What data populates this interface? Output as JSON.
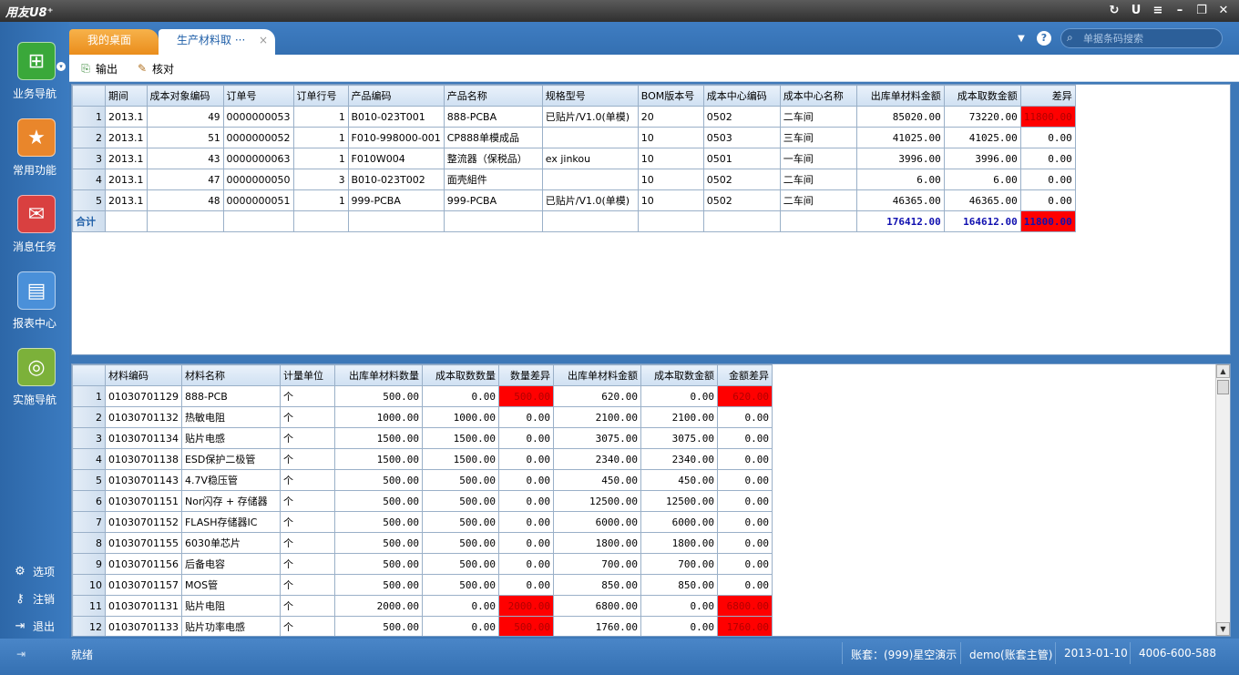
{
  "app": {
    "logo": "用友U8⁺"
  },
  "window_controls": {
    "refresh": "↻",
    "u": "U",
    "menu": "≡",
    "minimize": "–",
    "restore": "❐",
    "close": "✕"
  },
  "sidebar": {
    "items": [
      {
        "label": "业务导航",
        "icon": "tree-icon",
        "glyph": "⊞",
        "color": "#3aa83a"
      },
      {
        "label": "常用功能",
        "icon": "star-icon",
        "glyph": "★",
        "color": "#e9862b"
      },
      {
        "label": "消息任务",
        "icon": "mail-icon",
        "glyph": "✉",
        "color": "#d94040"
      },
      {
        "label": "报表中心",
        "icon": "report-icon",
        "glyph": "▤",
        "color": "#4a90d9"
      },
      {
        "label": "实施导航",
        "icon": "compass-icon",
        "glyph": "◎",
        "color": "#7cb13a"
      }
    ],
    "more_glyph": "▾",
    "links": [
      {
        "label": "选项",
        "glyph": "⚙"
      },
      {
        "label": "注销",
        "glyph": "⚷"
      },
      {
        "label": "退出",
        "glyph": "⇥"
      }
    ]
  },
  "tabs": {
    "desktop": "我的桌面",
    "doc": "生产材料取 ···",
    "close": "×"
  },
  "topbar": {
    "dropdown": "▼",
    "help": "?",
    "search_placeholder": "单据条码搜索",
    "search_glyph": "⌕"
  },
  "toolbar": {
    "export_label": "输出",
    "export_glyph": "⎘",
    "check_label": "核对",
    "check_glyph": "✎"
  },
  "grid1": {
    "columns": [
      "期间",
      "成本对象编码",
      "订单号",
      "订单行号",
      "产品编码",
      "产品名称",
      "规格型号",
      "BOM版本号",
      "成本中心编码",
      "成本中心名称",
      "出库单材料金额",
      "成本取数金额",
      "差异"
    ],
    "rows": [
      [
        "1",
        "2013.1",
        "49",
        "0000000053",
        "1",
        "B010-023T001",
        "888-PCBA",
        "已贴片/V1.0(单模)",
        "20",
        "0502",
        "二车间",
        "85020.00",
        "73220.00",
        "11800.00"
      ],
      [
        "2",
        "2013.1",
        "51",
        "0000000052",
        "1",
        "F010-998000-001",
        "CP888单模成品",
        "",
        "10",
        "0503",
        "三车间",
        "41025.00",
        "41025.00",
        "0.00"
      ],
      [
        "3",
        "2013.1",
        "43",
        "0000000063",
        "1",
        "F010W004",
        "整流器（保税品）",
        "ex jinkou",
        "10",
        "0501",
        "一车间",
        "3996.00",
        "3996.00",
        "0.00"
      ],
      [
        "4",
        "2013.1",
        "47",
        "0000000050",
        "3",
        "B010-023T002",
        "面壳組件",
        "",
        "10",
        "0502",
        "二车间",
        "6.00",
        "6.00",
        "0.00"
      ],
      [
        "5",
        "2013.1",
        "48",
        "0000000051",
        "1",
        "999-PCBA",
        "999-PCBA",
        "已贴片/V1.0(单模)",
        "10",
        "0502",
        "二车间",
        "46365.00",
        "46365.00",
        "0.00"
      ]
    ],
    "total": {
      "label": "合计",
      "out_amount": "176412.00",
      "cost_amount": "164612.00",
      "diff": "11800.00"
    }
  },
  "grid2": {
    "columns": [
      "材料编码",
      "材料名称",
      "计量单位",
      "出库单材料数量",
      "成本取数数量",
      "数量差异",
      "出库单材料金额",
      "成本取数金额",
      "金额差异"
    ],
    "rows": [
      [
        "1",
        "01030701129",
        "888-PCB",
        "个",
        "500.00",
        "0.00",
        "500.00",
        "620.00",
        "0.00",
        "620.00"
      ],
      [
        "2",
        "01030701132",
        "热敏电阻",
        "个",
        "1000.00",
        "1000.00",
        "0.00",
        "2100.00",
        "2100.00",
        "0.00"
      ],
      [
        "3",
        "01030701134",
        "贴片电感",
        "个",
        "1500.00",
        "1500.00",
        "0.00",
        "3075.00",
        "3075.00",
        "0.00"
      ],
      [
        "4",
        "01030701138",
        "ESD保护二极管",
        "个",
        "1500.00",
        "1500.00",
        "0.00",
        "2340.00",
        "2340.00",
        "0.00"
      ],
      [
        "5",
        "01030701143",
        "4.7V稳压管",
        "个",
        "500.00",
        "500.00",
        "0.00",
        "450.00",
        "450.00",
        "0.00"
      ],
      [
        "6",
        "01030701151",
        "Nor闪存 + 存储器",
        "个",
        "500.00",
        "500.00",
        "0.00",
        "12500.00",
        "12500.00",
        "0.00"
      ],
      [
        "7",
        "01030701152",
        "FLASH存储器IC",
        "个",
        "500.00",
        "500.00",
        "0.00",
        "6000.00",
        "6000.00",
        "0.00"
      ],
      [
        "8",
        "01030701155",
        "6030单芯片",
        "个",
        "500.00",
        "500.00",
        "0.00",
        "1800.00",
        "1800.00",
        "0.00"
      ],
      [
        "9",
        "01030701156",
        "后备电容",
        "个",
        "500.00",
        "500.00",
        "0.00",
        "700.00",
        "700.00",
        "0.00"
      ],
      [
        "10",
        "01030701157",
        "MOS管",
        "个",
        "500.00",
        "500.00",
        "0.00",
        "850.00",
        "850.00",
        "0.00"
      ],
      [
        "11",
        "01030701131",
        "贴片电阻",
        "个",
        "2000.00",
        "0.00",
        "2000.00",
        "6800.00",
        "0.00",
        "6800.00"
      ],
      [
        "12",
        "01030701133",
        "贴片功率电感",
        "个",
        "500.00",
        "0.00",
        "500.00",
        "1760.00",
        "0.00",
        "1760.00"
      ]
    ]
  },
  "scrollbar": {
    "up": "▲",
    "down": "▼"
  },
  "statusbar": {
    "pin_glyph": "⇥",
    "status": "就绪",
    "account": "账套：(999)星空演示",
    "user": "demo(账套主管)",
    "date": "2013-01-10",
    "phone": "4006-600-588"
  },
  "colors": {
    "diff_highlight": "#ff0000",
    "total_text": "#1010b0"
  }
}
